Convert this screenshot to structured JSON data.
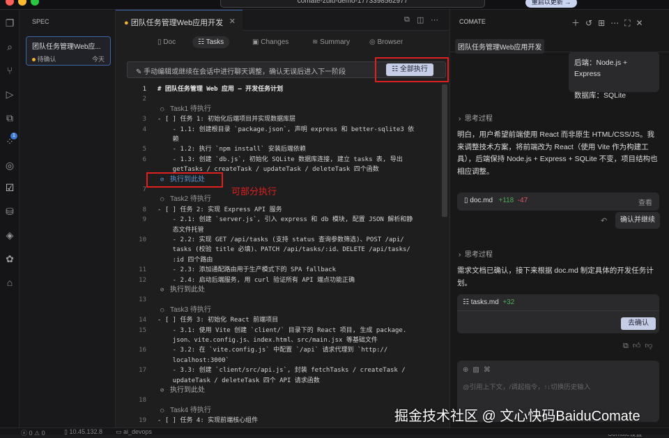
{
  "titlebar": {
    "project": "comate-zulu-demo-1773398562977",
    "restart_label": "重启以更新 →"
  },
  "activity": {
    "badge": "1"
  },
  "spec": {
    "title": "SPEC",
    "card": {
      "name": "团队任务管理Web应...",
      "status": "待确认",
      "date": "今天"
    }
  },
  "editor": {
    "tab": "团队任务管理Web应用开发",
    "subtabs": [
      "Doc",
      "Tasks",
      "Changes",
      "Summary",
      "Browser"
    ],
    "banner": "手动编辑或继续在会话中进行聊天调整，确认无误后进入下一阶段",
    "run_all": "全部执行",
    "annotation": "可部分执行",
    "lines": [
      {
        "kind": "h1",
        "num": "1",
        "text": "# 团队任务管理 Web 应用 – 开发任务计划"
      },
      {
        "kind": "code",
        "num": "2",
        "text": ""
      },
      {
        "kind": "task",
        "num": "",
        "text": "Task1 待执行"
      },
      {
        "kind": "code",
        "num": "3",
        "text": "- [ ] 任务 1: 初始化后端项目并实现数据库层"
      },
      {
        "kind": "code",
        "num": "4",
        "text": "    - 1.1: 创建根目录 `package.json`, 声明 express 和 better-sqlite3 依"
      },
      {
        "kind": "code",
        "num": "",
        "text": "    赖"
      },
      {
        "kind": "code",
        "num": "5",
        "text": "    - 1.2: 执行 `npm install` 安装后端依赖"
      },
      {
        "kind": "code",
        "num": "6",
        "text": "    - 1.3: 创建 `db.js`, 初始化 SQLite 数据库连接, 建立 tasks 表, 导出"
      },
      {
        "kind": "code",
        "num": "",
        "text": "    getTasks / createTask / updateTask / deleteTask 四个函数"
      },
      {
        "kind": "exec hl",
        "num": "",
        "text": "执行到此处"
      },
      {
        "kind": "code",
        "num": "7",
        "text": ""
      },
      {
        "kind": "task",
        "num": "",
        "text": "Task2 待执行"
      },
      {
        "kind": "code",
        "num": "8",
        "text": "- [ ] 任务 2: 实现 Express API 服务"
      },
      {
        "kind": "code",
        "num": "9",
        "text": "    - 2.1: 创建 `server.js`, 引入 express 和 db 模块, 配置 JSON 解析和静"
      },
      {
        "kind": "code",
        "num": "",
        "text": "    态文件托管"
      },
      {
        "kind": "code",
        "num": "10",
        "text": "    - 2.2: 实现 GET /api/tasks (支持 status 查询参数筛选)、POST /api/"
      },
      {
        "kind": "code",
        "num": "",
        "text": "    tasks (校验 title 必填)、PATCH /api/tasks/:id、DELETE /api/tasks/"
      },
      {
        "kind": "code",
        "num": "",
        "text": "    :id 四个路由"
      },
      {
        "kind": "code",
        "num": "11",
        "text": "    - 2.3: 添加通配路由用于生产模式下的 SPA fallback"
      },
      {
        "kind": "code",
        "num": "12",
        "text": "    - 2.4: 启动后端服务, 用 curl 验证所有 API 端点功能正确"
      },
      {
        "kind": "exec",
        "num": "",
        "text": "执行到此处"
      },
      {
        "kind": "code",
        "num": "13",
        "text": ""
      },
      {
        "kind": "task",
        "num": "",
        "text": "Task3 待执行"
      },
      {
        "kind": "code",
        "num": "14",
        "text": "- [ ] 任务 3: 初始化 React 前端项目"
      },
      {
        "kind": "code",
        "num": "15",
        "text": "    - 3.1: 使用 Vite 创建 `client/` 目录下的 React 项目, 生成 package."
      },
      {
        "kind": "code",
        "num": "",
        "text": "    json、vite.config.js、index.html、src/main.jsx 等基础文件"
      },
      {
        "kind": "code",
        "num": "16",
        "text": "    - 3.2: 在 `vite.config.js` 中配置 `/api` 请求代理到 `http://"
      },
      {
        "kind": "code",
        "num": "",
        "text": "    localhost:3000`"
      },
      {
        "kind": "code",
        "num": "17",
        "text": "    - 3.3: 创建 `client/src/api.js`, 封装 fetchTasks / createTask /"
      },
      {
        "kind": "code",
        "num": "",
        "text": "    updateTask / deleteTask 四个 API 请求函数"
      },
      {
        "kind": "exec",
        "num": "",
        "text": "执行到此处"
      },
      {
        "kind": "code",
        "num": "18",
        "text": ""
      },
      {
        "kind": "task",
        "num": "",
        "text": "Task4 待执行"
      },
      {
        "kind": "code",
        "num": "19",
        "text": "- [ ] 任务 4: 实现前端核心组件"
      }
    ]
  },
  "right": {
    "title": "COMATE",
    "session_chip": "团队任务管理Web应用开发",
    "user_msg": {
      "line1": "后端：Node.js + Express",
      "line2": "数据库：SQLite"
    },
    "thinking_label": "思考过程",
    "reply1": "明白，用户希望前端使用 React 而非原生 HTML/CSS/JS。我来调整技术方案，将前端改为 React（使用 Vite 作为构建工具），后端保持 Node.js + Express + SQLite 不变，项目结构也相应调整。",
    "file1": {
      "name": "doc.md",
      "added": "+118",
      "removed": "-47",
      "view": "查看"
    },
    "confirm_continue": "确认并继续",
    "reply2": "需求文档已确认，接下来根据 doc.md 制定具体的开发任务计划。",
    "file2": {
      "name": "tasks.md",
      "added": "+32",
      "confirm": "去确认"
    },
    "input_placeholder": "@引用上下文，/调起指令，↑↓切换历史输入",
    "settings": "Comate设置"
  },
  "statusbar": {
    "errors": "0",
    "warnings": "0",
    "ip": "10.45.132.8",
    "branch": "ai_devops"
  },
  "watermark": "掘金技术社区 @ 文心快码BaiduComate",
  "colors": {
    "accent": "#3b66a8",
    "annotation": "#e0201e",
    "added": "#4caf50",
    "removed": "#e05561"
  }
}
